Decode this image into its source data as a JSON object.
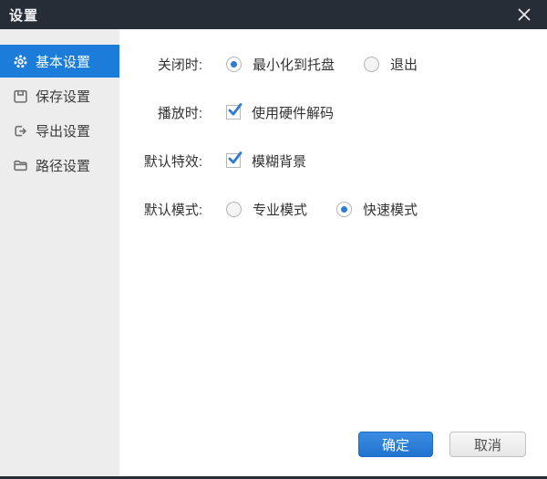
{
  "window": {
    "title": "设置",
    "close_icon": "close-x"
  },
  "sidebar": {
    "items": [
      {
        "label": "基本设置",
        "icon": "gear-icon",
        "selected": true
      },
      {
        "label": "保存设置",
        "icon": "save-icon",
        "selected": false
      },
      {
        "label": "导出设置",
        "icon": "export-icon",
        "selected": false
      },
      {
        "label": "路径设置",
        "icon": "folder-icon",
        "selected": false
      }
    ]
  },
  "form": {
    "rows": [
      {
        "label": "关闭时:",
        "type": "radio-group",
        "options": [
          {
            "label": "最小化到托盘",
            "selected": true
          },
          {
            "label": "退出",
            "selected": false
          }
        ]
      },
      {
        "label": "播放时:",
        "type": "checkbox",
        "options": [
          {
            "label": "使用硬件解码",
            "checked": true
          }
        ]
      },
      {
        "label": "默认特效:",
        "type": "checkbox",
        "options": [
          {
            "label": "模糊背景",
            "checked": true
          }
        ]
      },
      {
        "label": "默认模式:",
        "type": "radio-group",
        "options": [
          {
            "label": "专业模式",
            "selected": false
          },
          {
            "label": "快速模式",
            "selected": true
          }
        ]
      }
    ]
  },
  "footer": {
    "ok_label": "确定",
    "cancel_label": "取消"
  },
  "colors": {
    "titlebar_bg": "#272d37",
    "sidebar_bg": "#ededee",
    "selected_item_bg": "#1b7cd9",
    "accent_blue": "#2e7bd2",
    "ok_button_bg": "#2a7fd8",
    "cancel_button_bg": "#f0f0f0",
    "text_dark": "#333333"
  }
}
